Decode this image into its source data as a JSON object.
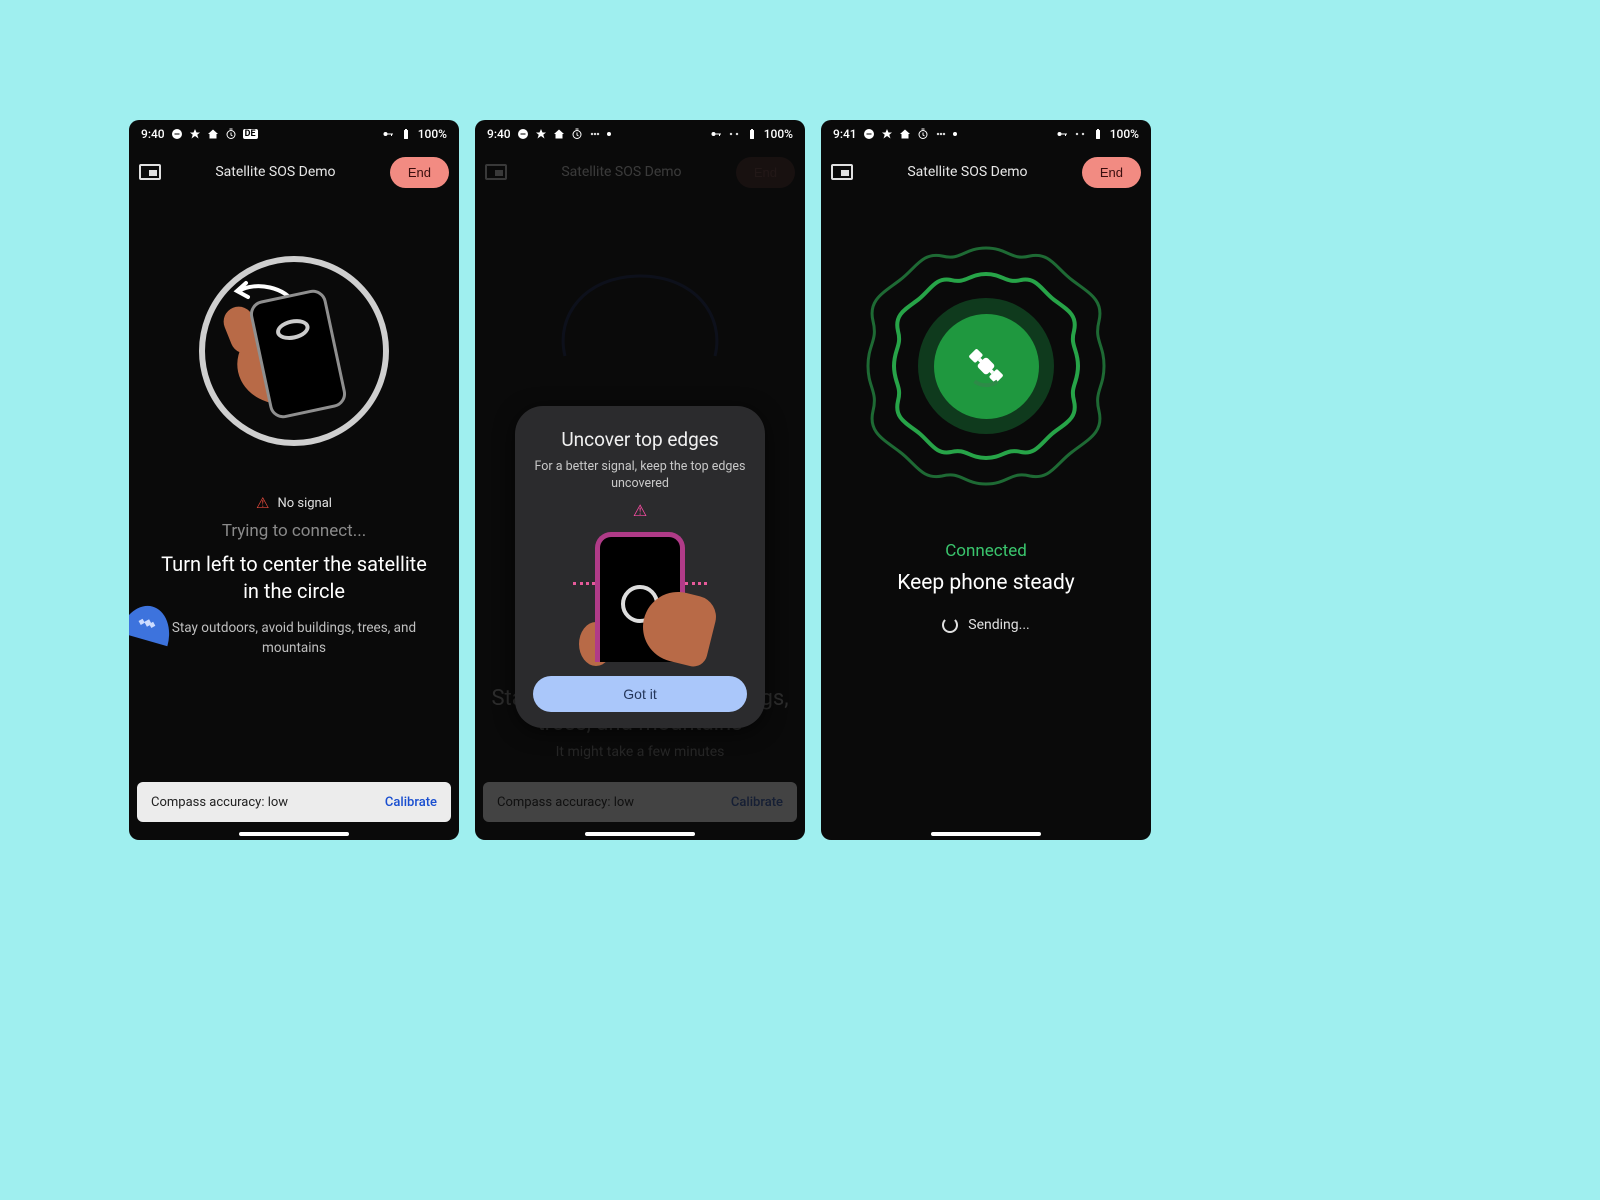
{
  "status": {
    "time_a": "9:40",
    "time_b": "9:41",
    "battery": "100%"
  },
  "app": {
    "title": "Satellite SOS Demo",
    "end": "End"
  },
  "screen1": {
    "no_signal": "No signal",
    "status": "Trying to connect...",
    "title": "Turn left to center the satellite in the circle",
    "hint": "Stay outdoors, avoid buildings, trees, and mountains"
  },
  "screen2": {
    "dialog_title": "Uncover top edges",
    "dialog_body": "For a better signal, keep the top edges uncovered",
    "gotit": "Got it",
    "bg_title": "Stay outdoors, avoid buildings, trees, and mountains",
    "bg_sub": "It might take a few minutes"
  },
  "screen3": {
    "connected": "Connected",
    "title": "Keep phone steady",
    "sending": "Sending..."
  },
  "compass": {
    "label": "Compass accuracy: low",
    "calibrate": "Calibrate"
  }
}
